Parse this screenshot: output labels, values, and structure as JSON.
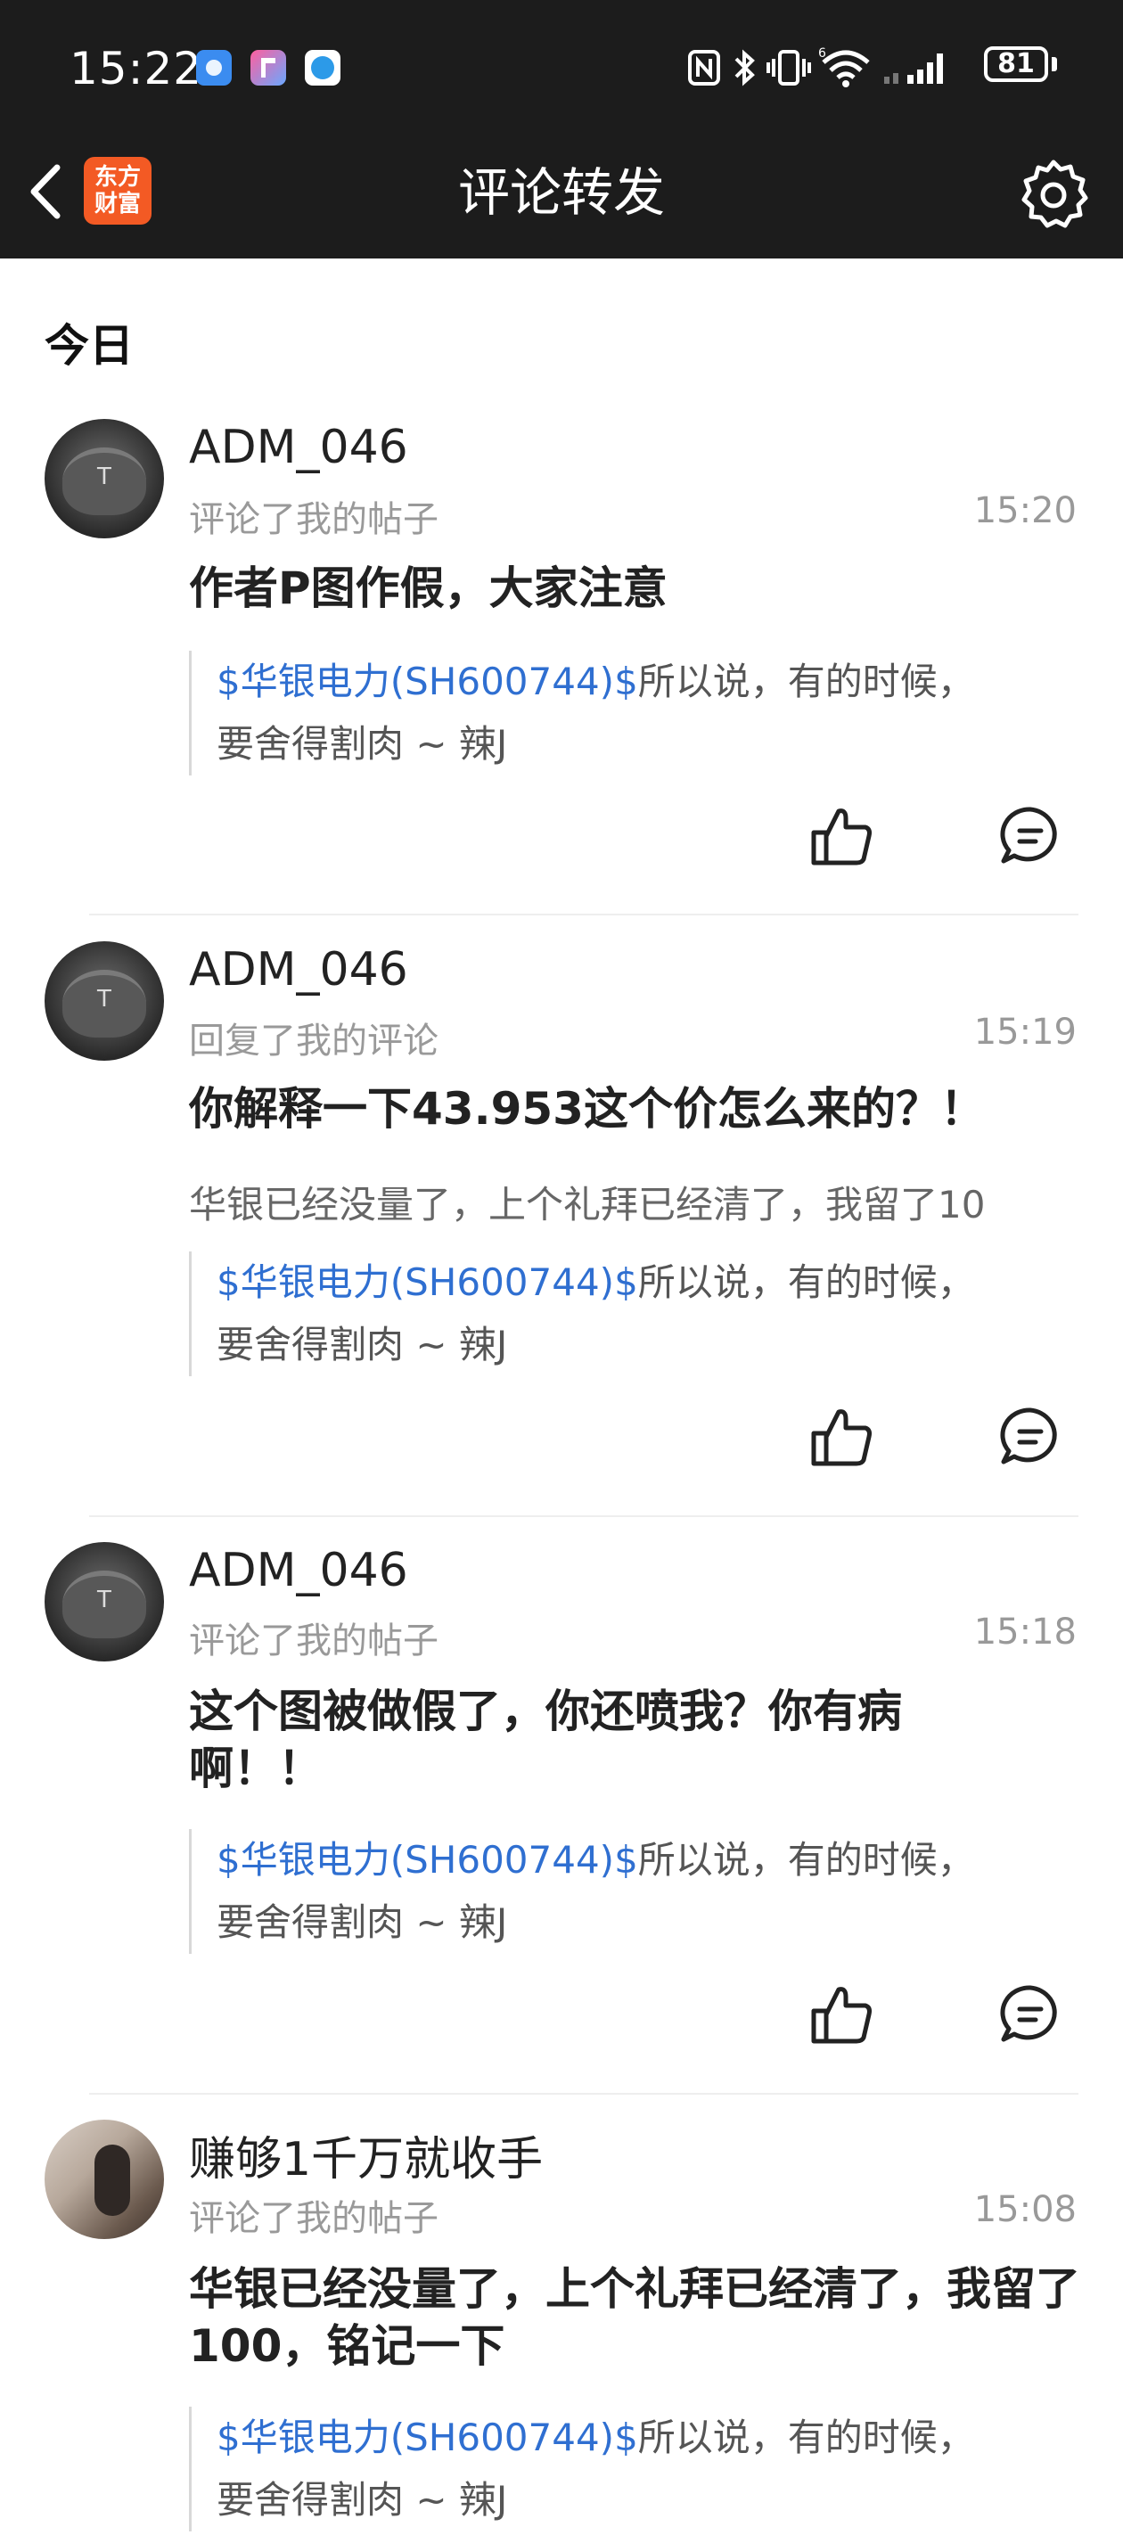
{
  "status_bar": {
    "time": "15:22",
    "battery": "81"
  },
  "header": {
    "logo_line1": "东方",
    "logo_line2": "财富",
    "title": "评论转发"
  },
  "section_title": "今日",
  "items": [
    {
      "user": "ADM_046",
      "action": "评论了我的帖子",
      "time": "15:20",
      "comment": "作者P图作假，大家注意",
      "reply": "",
      "quote_tag": "$华银电力(SH600744)$",
      "quote_rest": "所以说，有的时候，",
      "quote_line2": "要舍得割肉 ~ 辣J"
    },
    {
      "user": "ADM_046",
      "action": "回复了我的评论",
      "time": "15:19",
      "comment": "你解释一下43.953这个价怎么来的？！",
      "reply": "华银已经没量了，上个礼拜已经清了，我留了10",
      "quote_tag": "$华银电力(SH600744)$",
      "quote_rest": "所以说，有的时候，",
      "quote_line2": "要舍得割肉 ~ 辣J"
    },
    {
      "user": "ADM_046",
      "action": "评论了我的帖子",
      "time": "15:18",
      "comment": "这个图被做假了，你还喷我？你有病啊！！",
      "reply": "",
      "quote_tag": "$华银电力(SH600744)$",
      "quote_rest": "所以说，有的时候，",
      "quote_line2": "要舍得割肉 ~ 辣J"
    },
    {
      "user": "赚够1千万就收手",
      "action": "评论了我的帖子",
      "time": "15:08",
      "comment": "华银已经没量了，上个礼拜已经清了，我留了100，铭记一下",
      "reply": "",
      "quote_tag": "$华银电力(SH600744)$",
      "quote_rest": "所以说，有的时候，",
      "quote_line2": "要舍得割肉 ~ 辣J"
    }
  ]
}
